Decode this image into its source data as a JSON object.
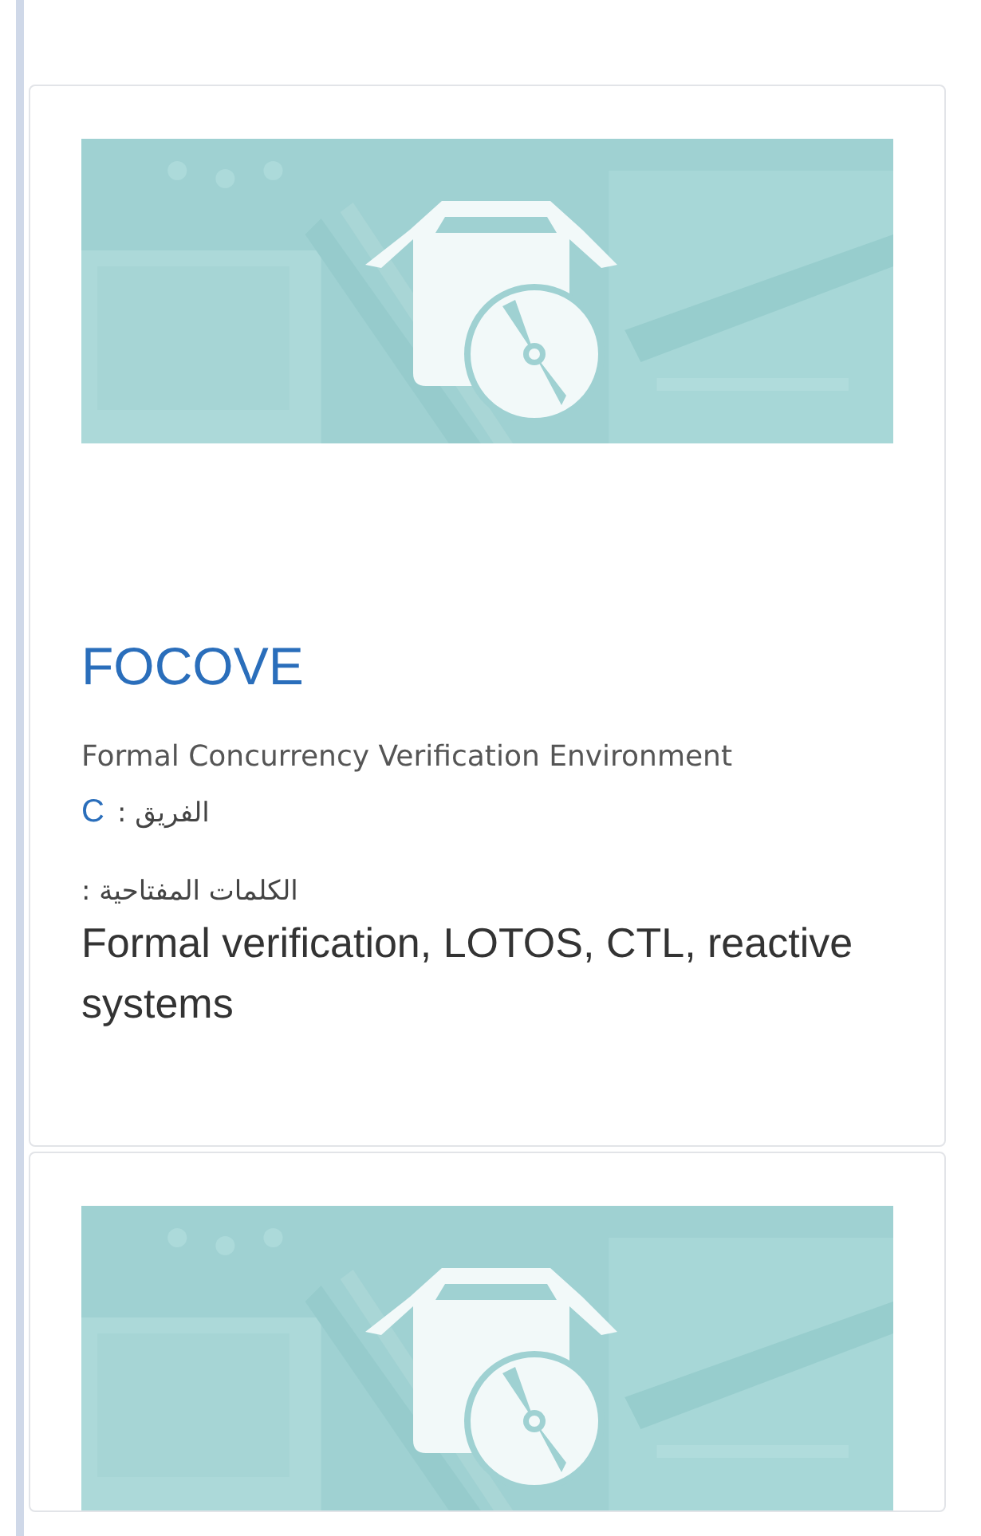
{
  "cards": [
    {
      "image": {
        "kind": "picture"
      },
      "title": "FOCOVE",
      "description": "Formal Concurrency Verification Environment",
      "team": {
        "label": "الفريق :",
        "value": "C"
      },
      "keywords": {
        "label": "الكلمات المفتاحية :",
        "value": "Formal verification, LOTOS, CTL, reactive systems"
      }
    },
    {
      "image": {
        "kind": "picture"
      }
    }
  ]
}
